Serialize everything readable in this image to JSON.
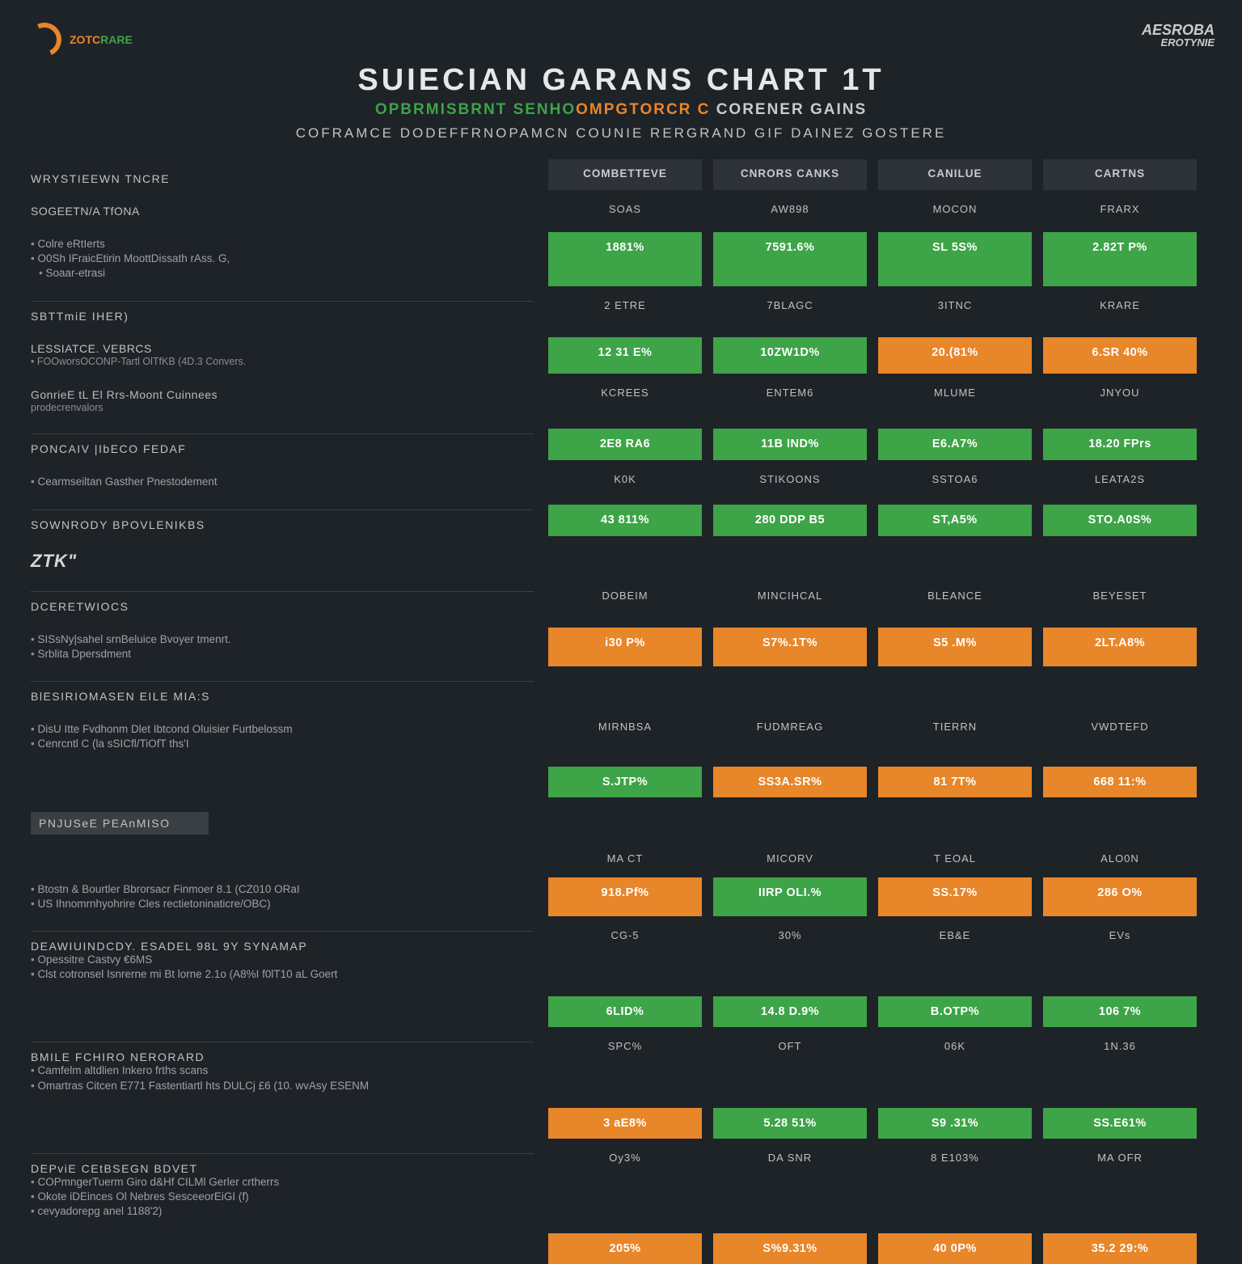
{
  "chart_data": {
    "type": "table",
    "title": "SUIECIAN GARANS CHART 1T",
    "columns": [
      "COMBETTEVE",
      "CNRORS CANKS",
      "CANILUE",
      "CARTNS"
    ],
    "row_groups": [
      {
        "labels": [
          "SOAS",
          "AW898",
          "MOCON",
          "FRARX"
        ],
        "values": [
          "1881%",
          "7591.6%",
          "SL 5S%",
          "2.82T P%"
        ],
        "colors": [
          "grn",
          "grn",
          "grn",
          "grn"
        ]
      },
      {
        "labels": [
          "2 ETRE",
          "7BLAGC",
          "3ITNC",
          "KRARE"
        ],
        "values": [
          "12 31 E%",
          "10ZW1D%",
          "20.(81%",
          "6.SR 40%"
        ],
        "colors": [
          "grn",
          "grn",
          "org",
          "org"
        ]
      },
      {
        "labels": [
          "KCREES",
          "ENTEM6",
          "MLUME",
          "JNYOU"
        ],
        "values": [
          "2E8 RA6",
          "11B IND%",
          "E6.A7%",
          "18.20 FPrs"
        ],
        "colors": [
          "grn",
          "grn",
          "grn",
          "grn"
        ]
      },
      {
        "labels": [
          "K0K",
          "STIKOONS",
          "SSTOA6",
          "LEATA2S"
        ],
        "values": [
          "43 811%",
          "280 DDP B5",
          "ST,A5%",
          "STO.A0S%"
        ],
        "colors": [
          "grn",
          "grn",
          "grn",
          "grn"
        ]
      },
      {
        "labels": [
          "DOBEIM",
          "MINCIHCAL",
          "BLEANCE",
          "BEYESET"
        ],
        "values": [
          "i30 P%",
          "S7%.1T%",
          "S5 .M%",
          "2LT.A8%"
        ],
        "colors": [
          "org",
          "org",
          "org",
          "org"
        ]
      },
      {
        "labels": [
          "MIRNBSA",
          "FUDMREAG",
          "TIERRN",
          "VWDTEFD"
        ],
        "values": [
          "S.JTP%",
          "SS3A.SR%",
          "81 7T%",
          "668 11:%"
        ],
        "colors": [
          "grn",
          "org",
          "org",
          "org"
        ]
      },
      {
        "labels": [
          "MA CT",
          "MICORV",
          "T EOAL",
          "ALO0N"
        ],
        "values": [
          "918.Pf%",
          "IIRP OLI.%",
          "SS.17%",
          "286 O%"
        ],
        "colors": [
          "org",
          "grn",
          "org",
          "org"
        ]
      },
      {
        "labels": [
          "CG-5",
          "30%",
          "EB&E",
          "EVs"
        ],
        "values": [
          "6LID%",
          "14.8 D.9%",
          "B.OTP%",
          "106 7%"
        ],
        "colors": [
          "grn",
          "grn",
          "grn",
          "grn"
        ]
      },
      {
        "labels": [
          "SPC%",
          "OFT",
          "06K",
          "1N.36"
        ],
        "values": [
          "3 aE8%",
          "5.28 51%",
          "S9 .31%",
          "SS.E61%"
        ],
        "colors": [
          "org",
          "grn",
          "grn",
          "grn"
        ]
      },
      {
        "labels": [
          "Oy3%",
          "DA SNR",
          "8 E103%",
          "MA OFR"
        ],
        "values": [
          "205%",
          "S%9.31%",
          "40 0P%",
          "35.2 29:%"
        ],
        "colors": [
          "org",
          "org",
          "org",
          "org"
        ]
      }
    ]
  },
  "logoL": {
    "o": "ZOTC",
    "g": "RARE"
  },
  "logoR": {
    "l1": "AESROBA",
    "l2": "EROTYNIE"
  },
  "title": "SUIECIAN GARANS CHART 1T",
  "sub1": {
    "a": "OPBRMISBRNT SENHO",
    "b": "OMPGTORCR C ",
    "c": "CORENER GAINS"
  },
  "sub2": "COFRAMCE DODEFFRNOPAMCN COUNIE RERGRAND GIF DAINEZ GOSTERE",
  "cols": [
    "COMBETTEVE",
    "CNRORS CANKS",
    "CANILUE",
    "CARTNS"
  ],
  "left": {
    "h0": "WRYSTIEEWN TNCRE",
    "h1": "SOGEETN/A TfONA",
    "b1a": "Colre eRtIerts",
    "b1b": "O0Sh IFraicEtirin MoottDissath rAss. G,",
    "b1c": "Soaar-etrasi",
    "h2": "SBTTmiE IHER)",
    "h3": "LESSIATCE. VEBRCS",
    "b3a": "FOOworsOCONP-Tartl OlTfKB (4D.3 Convers.",
    "h4": "GonrieE tL El Rrs-Moont Cuinnees",
    "b4a": "prodecrenvalors",
    "h5": "PONCAIV |IbECO FEDAF",
    "b5a": "Cearmseiltan Gasther Pnestodement",
    "h6": "SOWNRODY BPOVLENIKBS",
    "big": "ZTK\"",
    "h7": "DCERETWIOCS",
    "b7a": "SISsNy|sahel srnBeluice Bvoyer tmenrt.",
    "b7b": "Srblita Dpersdment",
    "h8": "BlESIRIOMASEN EILE MIA:S",
    "b8a": "DisU Itte Fvdhonm Dlet Ibtcond Oluisier Furtbelossm",
    "b8b": "Cenrcntl C (la sSICfl/TiOfT ths'I",
    "h9": "PNJUSeE PEAnMISO",
    "b9a": "Btostn & Bourtler Bbrorsacr Finmoer 8.1 (CZ010 ORaI",
    "b9b": "US Ihnomrnhyohrire Cles rectietoninaticre/OBC)",
    "h10": "DEAWIUINDCDY. ESADEL 98L 9Y SYNAMAP",
    "b10a": "Opessitre Castvy €6MS",
    "b10b": "Clst cotronsel Isnrerne mi Bt lorne 2.1o (A8%I f0lT10 aL Goert",
    "h11": "BMILE FCHIRO NERORARD",
    "b11a": "Camfelm altdlien Inkero frths scans",
    "b11b": "Omartras Citcen E771 Fastentiartl hts DULCj £6 (10. wvAsy ESENM",
    "h12": "DEPviE CEtBSEGN BDVET",
    "b12a": "COPmngerTuerm Giro d&Hf CILMl Gerler crtherrs",
    "b12b": "Okote iDEinces Ol Nebres SesceeorEiGI (f)",
    "b12c": "cevyadorepg anel 1188'2)"
  },
  "g": [
    {
      "l": [
        "SOAS",
        "AW898",
        "MOCON",
        "FRARX"
      ],
      "v": [
        "1881%",
        "7591.6%",
        "SL 5S%",
        "2.82T P%"
      ],
      "c": [
        "grn",
        "grn",
        "grn",
        "grn"
      ]
    },
    {
      "l": [
        "2 ETRE",
        "7BLAGC",
        "3ITNC",
        "KRARE"
      ],
      "v": [
        "12 31 E%",
        "10ZW1D%",
        "20.(81%",
        "6.SR 40%"
      ],
      "c": [
        "grn",
        "grn",
        "org",
        "org"
      ]
    },
    {
      "l": [
        "KCREES",
        "ENTEM6",
        "MLUME",
        "JNYOU"
      ],
      "v": [
        "2E8 RA6",
        "11B IND%",
        "E6.A7%",
        "18.20 FPrs"
      ],
      "c": [
        "grn",
        "grn",
        "grn",
        "grn"
      ]
    },
    {
      "l": [
        "K0K",
        "STIKOONS",
        "SSTOA6",
        "LEATA2S"
      ],
      "v": [
        "43 811%",
        "280 DDP B5",
        "ST,A5%",
        "STO.A0S%"
      ],
      "c": [
        "grn",
        "grn",
        "grn",
        "grn"
      ]
    },
    {
      "l": [
        "DOBEIM",
        "MINCIHCAL",
        "BLEANCE",
        "BEYESET"
      ],
      "v": [
        "i30 P%",
        "S7%.1T%",
        "S5 .M%",
        "2LT.A8%"
      ],
      "c": [
        "org",
        "org",
        "org",
        "org"
      ]
    },
    {
      "l": [
        "MIRNBSA",
        "FUDMREAG",
        "TIERRN",
        "VWDTEFD"
      ],
      "v": [
        "S.JTP%",
        "SS3A.SR%",
        "81 7T%",
        "668 11:%"
      ],
      "c": [
        "grn",
        "org",
        "org",
        "org"
      ]
    },
    {
      "l": [
        "MA CT",
        "MICORV",
        "T EOAL",
        "ALO0N"
      ],
      "v": [
        "918.Pf%",
        "IIRP OLI.%",
        "SS.17%",
        "286 O%"
      ],
      "c": [
        "org",
        "grn",
        "org",
        "org"
      ]
    },
    {
      "l": [
        "CG-5",
        "30%",
        "EB&E",
        "EVs"
      ],
      "v": [
        "6LID%",
        "14.8 D.9%",
        "B.OTP%",
        "106 7%"
      ],
      "c": [
        "grn",
        "grn",
        "grn",
        "grn"
      ]
    },
    {
      "l": [
        "SPC%",
        "OFT",
        "06K",
        "1N.36"
      ],
      "v": [
        "3 aE8%",
        "5.28 51%",
        "S9 .31%",
        "SS.E61%"
      ],
      "c": [
        "org",
        "grn",
        "grn",
        "grn"
      ]
    },
    {
      "l": [
        "Oy3%",
        "DA SNR",
        "8 E103%",
        "MA OFR"
      ],
      "v": [
        "205%",
        "S%9.31%",
        "40 0P%",
        "35.2 29:%"
      ],
      "c": [
        "org",
        "org",
        "org",
        "org"
      ]
    }
  ]
}
